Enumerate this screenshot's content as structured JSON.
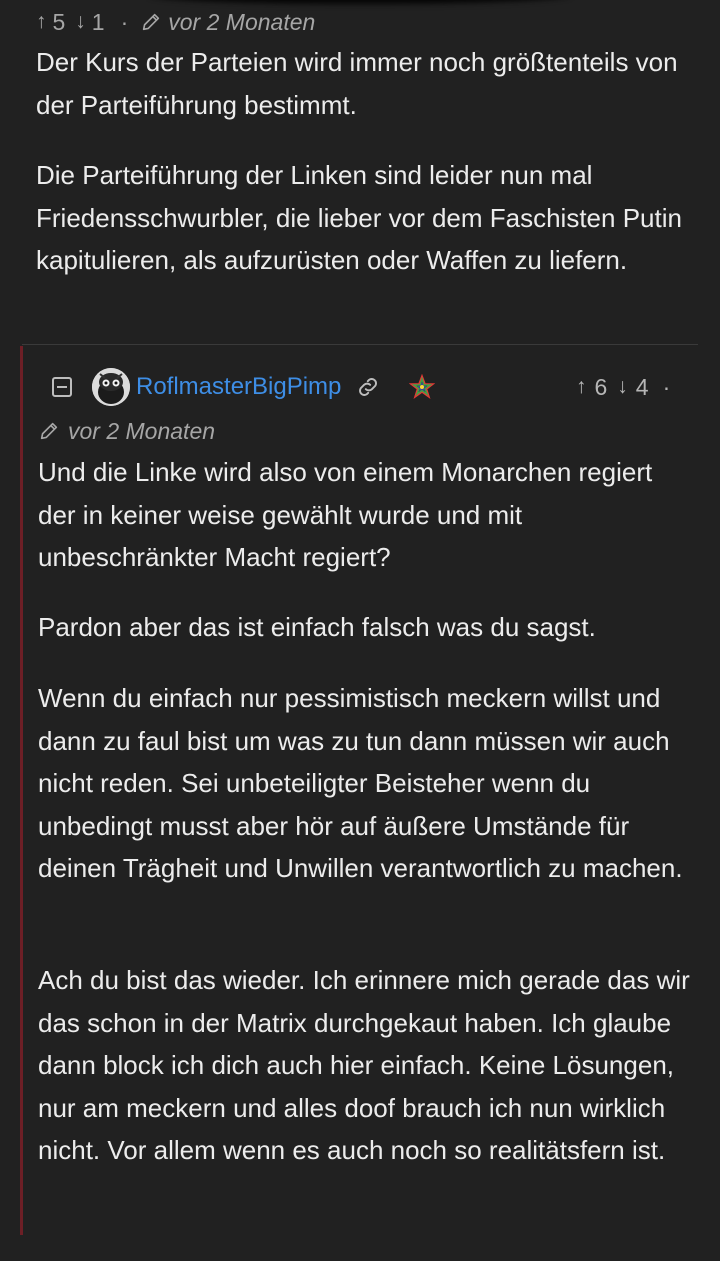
{
  "parent_comment": {
    "upvotes": "5",
    "downvotes": "1",
    "separator": "·",
    "time": "vor 2 Monaten",
    "paragraphs": [
      "Der Kurs der Parteien wird immer noch größtenteils von der Parteiführung bestimmt.",
      "Die Parteiführung der Linken sind leider nun mal Friedensschwurbler, die lieber vor dem Faschisten Putin kapitulieren, als aufzurüsten oder Waffen zu liefern."
    ]
  },
  "reply": {
    "username": "RoflmasterBigPimp",
    "upvotes": "6",
    "downvotes": "4",
    "separator": "·",
    "time": "vor 2 Monaten",
    "paragraphs": [
      "Und die Linke wird also von einem Monarchen regiert der in keiner weise gewählt wurde und mit unbeschränkter Macht regiert?",
      "Pardon aber das ist einfach falsch was du sagst.",
      "Wenn du einfach nur pessimistisch meckern willst und dann zu faul bist um was zu tun dann müssen wir auch nicht reden. Sei unbeteiligter Beisteher wenn du unbedingt musst aber hör auf äußere Umstände für deinen Trägheit und Unwillen verantwortlich zu machen.",
      "Ach du bist das wieder. Ich erinnere mich gerade das wir das schon in der Matrix durchgekaut haben. Ich glaube dann block ich dich auch hier einfach. Keine Lösungen, nur am meckern und alles doof brauch ich nun wirklich nicht. Vor allem wenn es auch noch so realitätsfern ist."
    ]
  },
  "icons": {
    "upvote": "arrow-up-icon",
    "downvote": "arrow-down-icon",
    "edited": "pencil-icon",
    "collapse": "collapse-minus-icon",
    "permalink": "link-icon",
    "badge": "rainbow-star-badge-icon"
  },
  "colors": {
    "background": "#212121",
    "text": "#ececec",
    "muted": "#a6a6a6",
    "username": "#3e8ee6",
    "thread_bar": "#6d1f26"
  }
}
